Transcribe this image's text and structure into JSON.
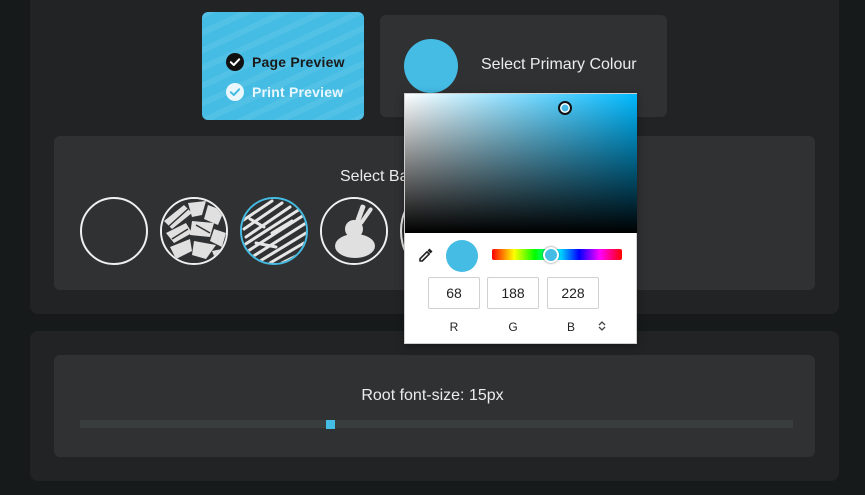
{
  "preview": {
    "page_label": "Page Preview",
    "print_label": "Print Preview"
  },
  "primary": {
    "label": "Select Primary Colour",
    "color": "#44bce4"
  },
  "background": {
    "label": "Select Ba",
    "patterns": [
      "none",
      "shards",
      "scribble",
      "palette",
      "partial"
    ],
    "selected": "scribble"
  },
  "font": {
    "label": "Root font-size: 15px",
    "value_fraction": 0.35
  },
  "picker": {
    "r": "68",
    "g": "188",
    "b": "228",
    "r_label": "R",
    "g_label": "G",
    "b_label": "B",
    "mode_icon": "up-down-arrows-icon"
  },
  "colors": {
    "accent": "#44bce4",
    "panel": "#222324",
    "card": "#303133",
    "background": "#171a1b"
  }
}
